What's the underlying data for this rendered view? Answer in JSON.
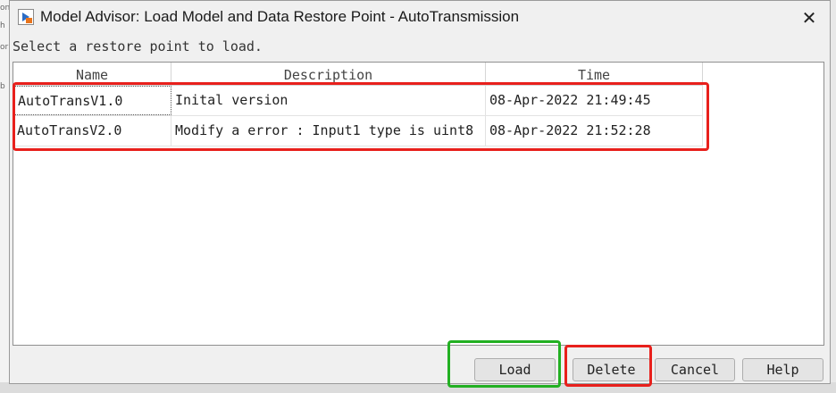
{
  "window": {
    "title": "Model Advisor: Load Model and Data Restore Point - AutoTransmission",
    "icon": "simulink-model-icon",
    "close_glyph": "✕"
  },
  "prompt": "Select a restore point to load.",
  "table": {
    "columns": [
      "Name",
      "Description",
      "Time"
    ],
    "rows": [
      {
        "name": "AutoTransV1.0",
        "description": "Inital version",
        "time": "08-Apr-2022 21:49:45"
      },
      {
        "name": "AutoTransV2.0",
        "description": "Modify a error : Input1 type is uint8",
        "time": "08-Apr-2022 21:52:28"
      }
    ]
  },
  "buttons": {
    "load": "Load",
    "delete": "Delete",
    "cancel": "Cancel",
    "help": "Help"
  },
  "annotations": {
    "rows_highlight_color": "#e8201c",
    "load_highlight_color": "#22b022",
    "delete_highlight_color": "#e8201c"
  },
  "background": {
    "fragments": [
      "on",
      "h",
      "or",
      "b"
    ]
  }
}
